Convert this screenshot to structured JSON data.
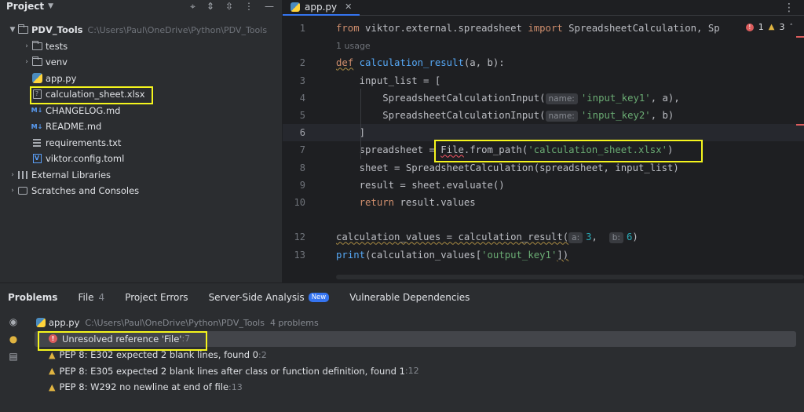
{
  "project": {
    "title": "Project",
    "root": {
      "name": "PDV_Tools",
      "path": "C:\\Users\\Paul\\OneDrive\\Python\\PDV_Tools"
    },
    "items": [
      {
        "label": "tests",
        "kind": "folder"
      },
      {
        "label": "venv",
        "kind": "folder"
      },
      {
        "label": "app.py",
        "kind": "python"
      },
      {
        "label": "calculation_sheet.xlsx",
        "kind": "unknown"
      },
      {
        "label": "CHANGELOG.md",
        "kind": "markdown"
      },
      {
        "label": "README.md",
        "kind": "markdown"
      },
      {
        "label": "requirements.txt",
        "kind": "text"
      },
      {
        "label": "viktor.config.toml",
        "kind": "viktor"
      }
    ],
    "external_libraries": "External Libraries",
    "scratches": "Scratches and Consoles",
    "md_prefix": "M↓",
    "unknown_glyph": "?",
    "viktor_glyph": "V"
  },
  "editor": {
    "tab_label": "app.py",
    "inspection": {
      "errors": "1",
      "warnings": "3"
    },
    "usage_hint": "1 usage",
    "hint_name": "name:",
    "hint_a": "a:",
    "hint_b": "b:",
    "line_numbers": [
      "1",
      "2",
      "3",
      "4",
      "5",
      "6",
      "7",
      "8",
      "9",
      "10",
      "12",
      "13"
    ],
    "code": {
      "l1_kw": "from",
      "l1_mod": " viktor.external.spreadsheet ",
      "l1_kw2": "import",
      "l1_rest": " SpreadsheetCalculation, Sp",
      "l2_kw": "def",
      "l2_fn": "calculation_result",
      "l2_rest": "(a, b):",
      "l3": "    input_list = [",
      "l4_a": "        SpreadsheetCalculationInput(",
      "l4_str": "'input_key1'",
      "l4_b": ", a),",
      "l5_a": "        SpreadsheetCalculationInput(",
      "l5_str": "'input_key2'",
      "l5_b": ", b)",
      "l6": "    ]",
      "l7_a": "    spreadsheet = ",
      "l7_err": "File",
      "l7_b": ".from_path(",
      "l7_str": "'calculation_sheet.xlsx'",
      "l7_c": ")",
      "l8": "    sheet = SpreadsheetCalculation(spreadsheet, input_list)",
      "l9": "    result = sheet.evaluate()",
      "l10_kw": "    return",
      "l10_rest": " result.values",
      "l12_a": "calculation_values = calculation_result(",
      "l12_n1": "3",
      "l12_sep": ",  ",
      "l12_n2": "6",
      "l12_b": ")",
      "l13_fn": "print",
      "l13_a": "(calculation_values[",
      "l13_str": "'output_key1'",
      "l13_b": "])"
    }
  },
  "problems": {
    "tabs": [
      {
        "label": "Problems"
      },
      {
        "label": "File",
        "count": "4"
      },
      {
        "label": "Project Errors"
      },
      {
        "label": "Server-Side Analysis",
        "badge": "New"
      },
      {
        "label": "Vulnerable Dependencies"
      }
    ],
    "file": {
      "name": "app.py",
      "path": "C:\\Users\\Paul\\OneDrive\\Python\\PDV_Tools",
      "summary": "4 problems"
    },
    "items": [
      {
        "severity": "error",
        "text": "Unresolved reference 'File'",
        "line": ":7"
      },
      {
        "severity": "warning",
        "text": "PEP 8: E302 expected 2 blank lines, found 0",
        "line": ":2"
      },
      {
        "severity": "warning",
        "text": "PEP 8: E305 expected 2 blank lines after class or function definition, found 1",
        "line": ":12"
      },
      {
        "severity": "warning",
        "text": "PEP 8: W292 no newline at end of file",
        "line": ":13"
      }
    ]
  },
  "colors": {
    "background": "#1e1f22",
    "panel": "#2b2d30",
    "highlight_box": "#f5f51d",
    "keyword": "#cf8e6d",
    "function": "#56a8f5",
    "string": "#6aab73",
    "error": "#db5c5c",
    "warning": "#e0b441",
    "accent": "#3574f0"
  },
  "icons": [
    "chevron-down-icon",
    "crosshair-icon",
    "expand-icon",
    "collapse-icon",
    "settings-icon",
    "hide-icon",
    "folder-icon",
    "python-file-icon",
    "unknown-file-icon",
    "markdown-icon",
    "text-file-icon",
    "viktor-icon",
    "library-icon",
    "scratches-icon",
    "close-icon",
    "more-icon",
    "eye-icon",
    "bulb-icon",
    "doc-icon",
    "error-icon",
    "warning-icon"
  ]
}
